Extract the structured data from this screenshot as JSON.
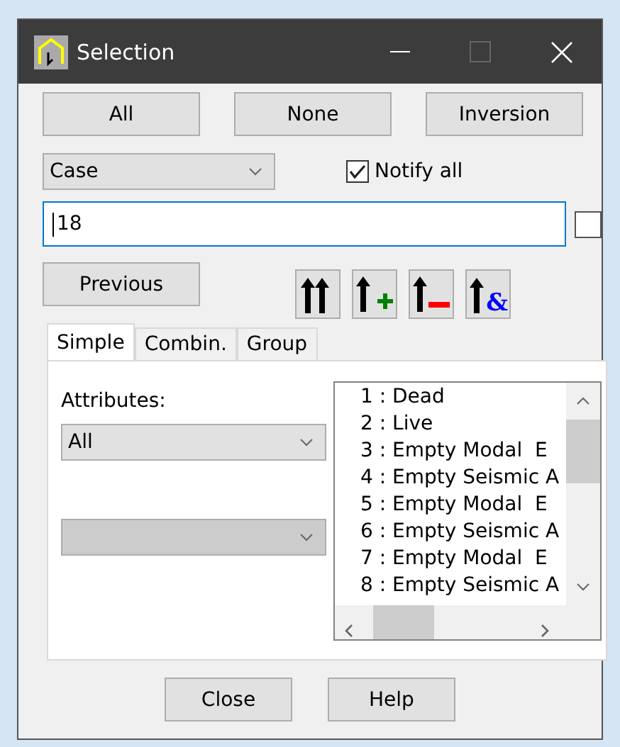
{
  "window": {
    "title": "Selection"
  },
  "top_buttons": [
    "All",
    "None",
    "Inversion"
  ],
  "type_dropdown": {
    "value": "Case"
  },
  "notify": {
    "label": "Notify all",
    "checked": true
  },
  "selection_field": {
    "value": "18"
  },
  "side_checkbox": {
    "checked": false
  },
  "previous_button": "Previous",
  "tool_buttons": [
    {
      "kind": "replace"
    },
    {
      "kind": "add"
    },
    {
      "kind": "remove"
    },
    {
      "kind": "intersect",
      "glyph": "&"
    }
  ],
  "tabs": [
    {
      "label": "Simple",
      "selected": true
    },
    {
      "label": "Combin.",
      "selected": false
    },
    {
      "label": "Group",
      "selected": false
    }
  ],
  "attributes": {
    "label": "Attributes:",
    "value": "All"
  },
  "second_dropdown": {
    "disabled": true
  },
  "list_items": [
    "1 : Dead",
    "2 : Live",
    "3 : Empty Modal  E",
    "4 : Empty Seismic A",
    "5 : Empty Modal  E",
    "6 : Empty Seismic A",
    "7 : Empty Modal  E",
    "8 : Empty Seismic A"
  ],
  "bottom_buttons": [
    "Close",
    "Help"
  ]
}
